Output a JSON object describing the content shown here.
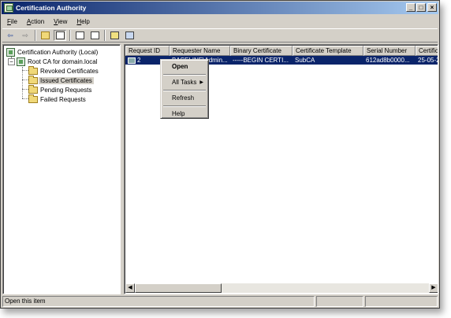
{
  "window": {
    "title": "Certification Authority"
  },
  "title_buttons": {
    "minimize": "_",
    "maximize": "□",
    "close": "×"
  },
  "menu": [
    {
      "label": "File",
      "accel": "F",
      "rest": "ile"
    },
    {
      "label": "Action",
      "accel": "A",
      "rest": "ction"
    },
    {
      "label": "View",
      "accel": "V",
      "rest": "iew"
    },
    {
      "label": "Help",
      "accel": "H",
      "rest": "elp"
    }
  ],
  "toolbar": {
    "icons": [
      "back-icon",
      "forward-icon",
      "up-folder-icon",
      "show-hide-tree-icon",
      "properties-icon",
      "export-list-icon",
      "help-icon",
      "console-icon"
    ],
    "back_glyph": "⇦",
    "forward_glyph": "⇨"
  },
  "tree": {
    "root": "Certification Authority (Local)",
    "ca": "Root CA for domain.local",
    "expander": "−",
    "folders": [
      {
        "label": "Revoked Certificates",
        "selected": false
      },
      {
        "label": "Issued Certificates",
        "selected": true
      },
      {
        "label": "Pending Requests",
        "selected": false
      },
      {
        "label": "Failed Requests",
        "selected": false
      }
    ]
  },
  "list": {
    "columns": [
      "Request ID",
      "Requester Name",
      "Binary Certificate",
      "Certificate Template",
      "Serial Number",
      "Certifica"
    ],
    "rows": [
      {
        "request_id": "2",
        "requester": "BASELINE\\Admin...",
        "binary": "-----BEGIN CERTI...",
        "template": "SubCA",
        "serial": "612ad8b0000...",
        "date": "25-05-2"
      }
    ]
  },
  "scrollbar": {
    "left_glyph": "◀",
    "right_glyph": "▶"
  },
  "context_menu": {
    "items": [
      {
        "label": "Open",
        "bold": true,
        "submenu": false
      },
      {
        "label": "All Tasks",
        "bold": false,
        "submenu": true
      },
      {
        "label": "Refresh",
        "bold": false,
        "submenu": false
      },
      {
        "label": "Help",
        "bold": false,
        "submenu": false
      }
    ],
    "submenu_glyph": "▶"
  },
  "status": {
    "text": "Open this item"
  },
  "colors": {
    "titlebar_start": "#0a246a",
    "titlebar_end": "#a6caf0",
    "selection": "#0a246a",
    "chrome": "#d4d0c8"
  }
}
